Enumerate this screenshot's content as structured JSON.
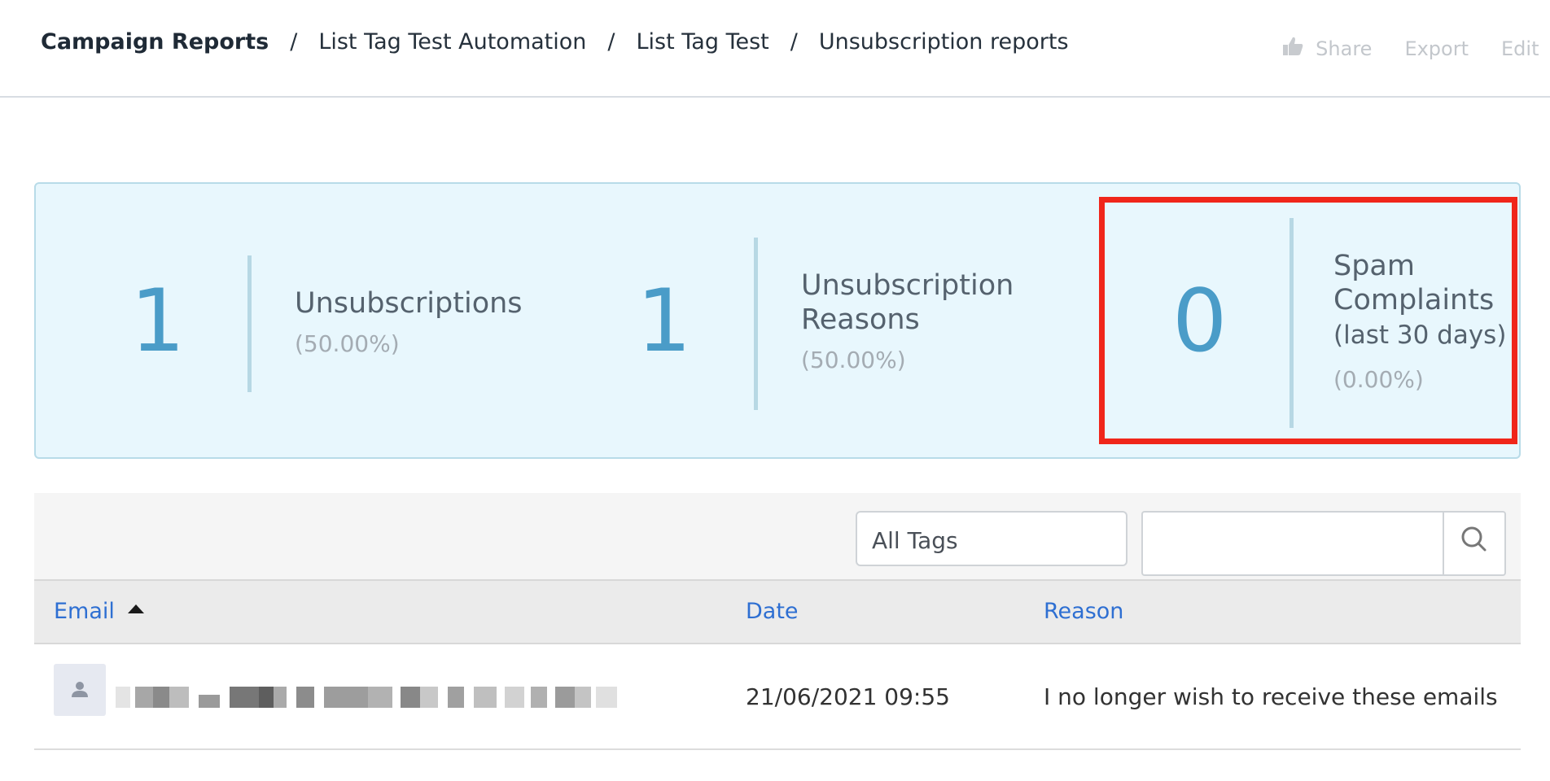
{
  "breadcrumb": {
    "root": "Campaign Reports",
    "items": [
      "List Tag Test Automation",
      "List Tag Test",
      "Unsubscription reports"
    ],
    "separator": "/"
  },
  "actions": {
    "share": "Share",
    "export": "Export",
    "edit": "Edit"
  },
  "stats": [
    {
      "value": "1",
      "label": "Unsubscriptions",
      "percent": "(50.00%)"
    },
    {
      "value": "1",
      "label": "Unsubscription Reasons",
      "percent": "(50.00%)"
    },
    {
      "value": "0",
      "label_main": "Spam Complaints",
      "label_suffix": "(last 30 days)",
      "percent": "(0.00%)"
    }
  ],
  "filters": {
    "tags_selected": "All Tags",
    "search_value": ""
  },
  "table": {
    "columns": [
      "Email",
      "Date",
      "Reason"
    ],
    "sort": {
      "column": "Email",
      "direction": "ascending"
    },
    "rows": [
      {
        "email": "",
        "date": "21/06/2021 09:55",
        "reason": "I no longer wish to receive these emails"
      }
    ]
  },
  "colors": {
    "accent": "#4a9cc8",
    "link": "#2e6fd2",
    "highlight": "#f0261a",
    "stats_bg": "#e8f7fd"
  }
}
